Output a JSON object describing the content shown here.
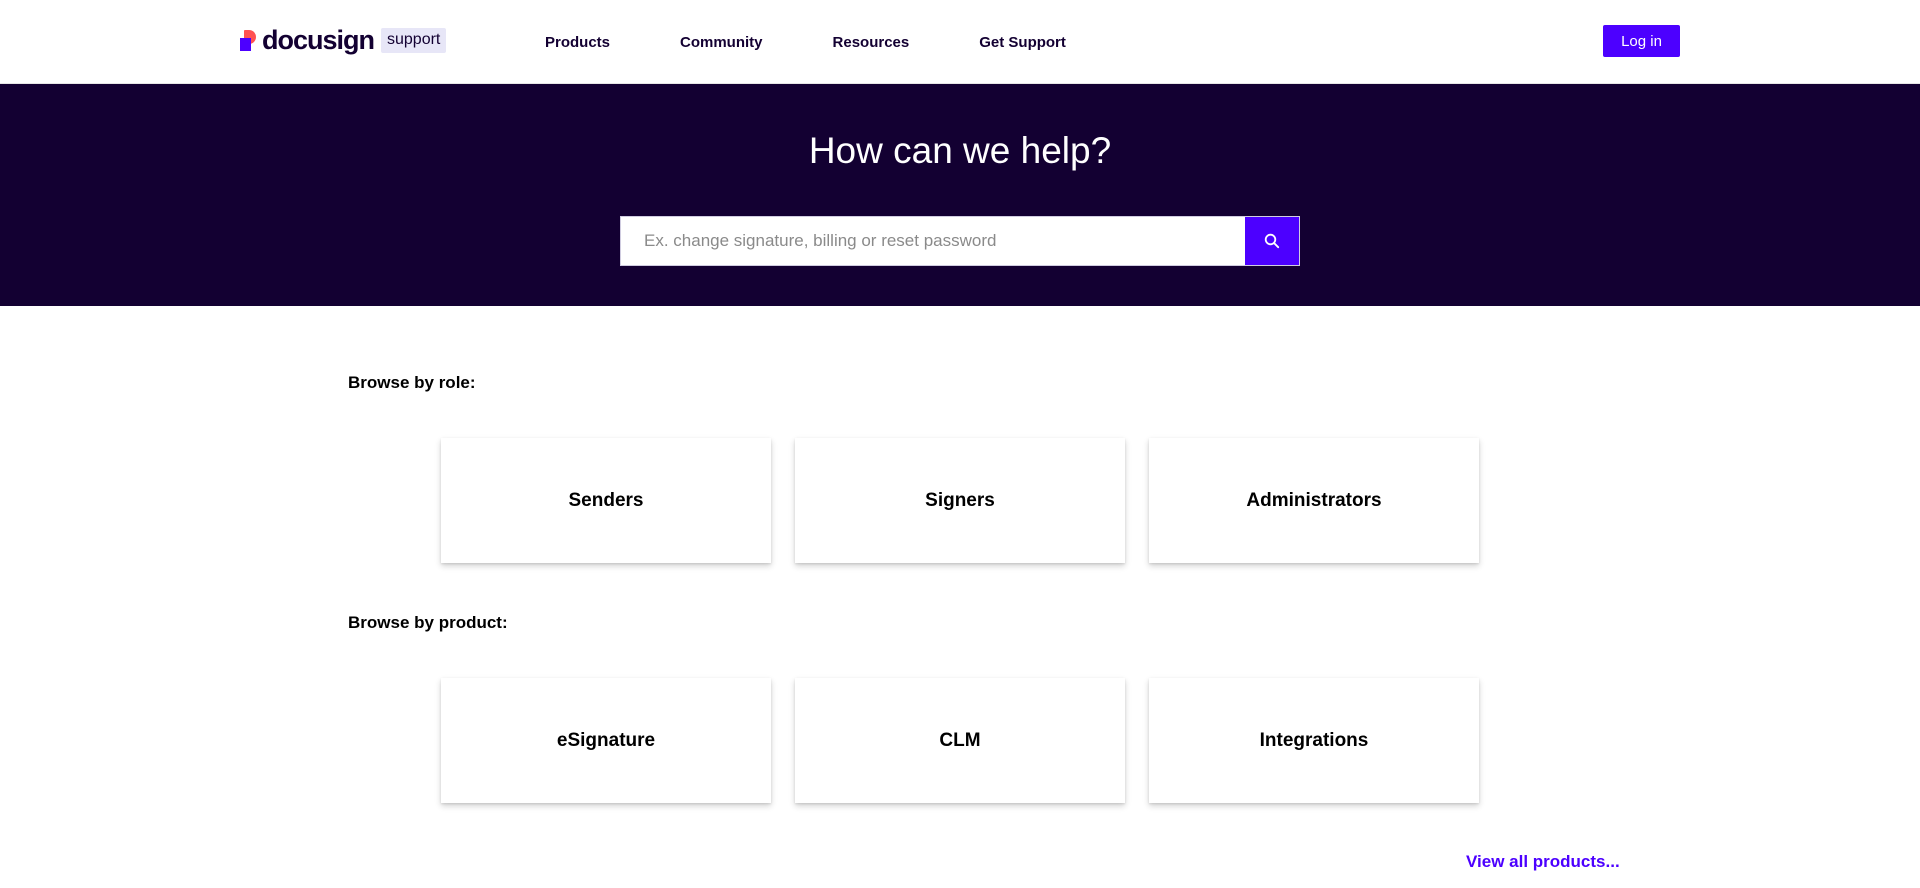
{
  "header": {
    "logo_word": "docusign",
    "logo_tag": "support",
    "nav": [
      "Products",
      "Community",
      "Resources",
      "Get Support"
    ],
    "login_label": "Log in"
  },
  "hero": {
    "title": "How can we help?",
    "search_placeholder": "Ex. change signature, billing or reset password"
  },
  "browse_role": {
    "title": "Browse by role:",
    "cards": [
      "Senders",
      "Signers",
      "Administrators"
    ]
  },
  "browse_product": {
    "title": "Browse by product:",
    "cards": [
      "eSignature",
      "CLM",
      "Integrations"
    ],
    "view_all": "View all products..."
  },
  "colors": {
    "brand_purple": "#4c00ff",
    "hero_bg": "#130032",
    "logo_red": "#ff5252"
  },
  "icons": {
    "search": "search-icon"
  }
}
